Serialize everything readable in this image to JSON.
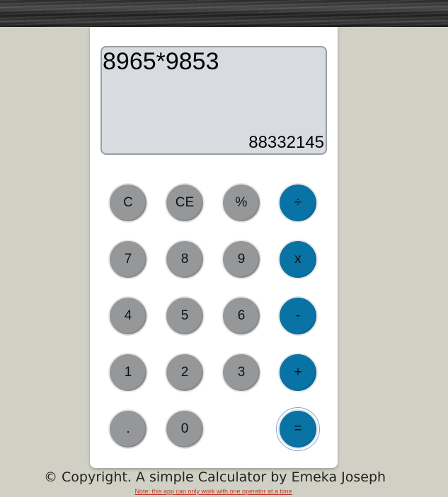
{
  "display": {
    "expression": "8965*9853",
    "result": "88332145"
  },
  "keys": {
    "clear": "C",
    "clear_entry": "CE",
    "percent": "%",
    "divide": "÷",
    "seven": "7",
    "eight": "8",
    "nine": "9",
    "multiply": "x",
    "four": "4",
    "five": "5",
    "six": "6",
    "minus": "-",
    "one": "1",
    "two": "2",
    "three": "3",
    "plus": "+",
    "decimal": ".",
    "zero": "0",
    "equals": "="
  },
  "footer": {
    "copyright": "© Copyright. A simple Calculator by Emeka Joseph",
    "note": "Note: this app can only work with one operator at a time"
  },
  "colors": {
    "page_background": "#d0d0c4",
    "number_key": "#969799",
    "operator_key": "#0a73a6",
    "display_background": "#d8dbe0",
    "note_text": "#c0392b"
  }
}
